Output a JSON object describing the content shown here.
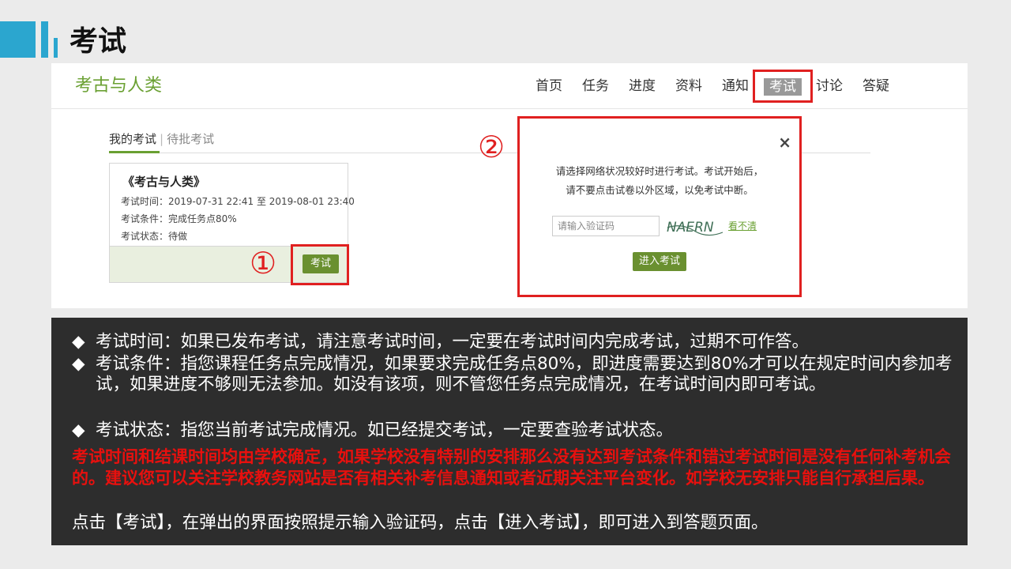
{
  "slide": {
    "title": "考试"
  },
  "site": {
    "logo": "考古与人类",
    "nav": [
      "首页",
      "任务",
      "进度",
      "资料",
      "通知",
      "考试",
      "讨论",
      "答疑"
    ]
  },
  "tabs": {
    "active": "我的考试",
    "separator": "|",
    "inactive": "待批考试"
  },
  "card": {
    "title": "《考古与人类》",
    "time": "考试时间：2019-07-31 22:41 至 2019-08-01 23:40",
    "condition": "考试条件：完成任务点80%",
    "status": "考试状态：待做",
    "button": "考试"
  },
  "markers": {
    "one": "①",
    "two": "②"
  },
  "modal": {
    "close": "×",
    "line1": "请选择网络状况较好时进行考试。考试开始后，",
    "line2": "请不要点击试卷以外区域，以免考试中断。",
    "placeholder": "请输入验证码",
    "captcha_text": "NAERN",
    "refresh": "看不清",
    "enter": "进入考试"
  },
  "notes": {
    "bullet": "◆",
    "items": [
      "考试时间：如果已发布考试，请注意考试时间，一定要在考试时间内完成考试，过期不可作答。",
      "考试条件：指您课程任务点完成情况，如果要求完成任务点80%，即进度需要达到80%才可以在规定时间内参加考试，如果进度不够则无法参加。如没有该项，则不管您任务点完成情况，在考试时间内即可考试。",
      "考试状态：指您当前考试完成情况。如已经提交考试，一定要查验考试状态。"
    ],
    "warning": "考试时间和结课时间均由学校确定，如果学校没有特别的安排那么没有达到考试条件和错过考试时间是没有任何补考机会的。建议您可以关注学校教务网站是否有相关补考信息通知或者近期关注平台变化。如学校无安排只能自行承担后果。",
    "instruction": "点击【考试】，在弹出的界面按照提示输入验证码，点击【进入考试】，即可进入到答题页面。"
  }
}
